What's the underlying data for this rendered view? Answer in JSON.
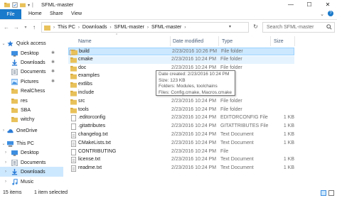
{
  "window": {
    "title": "SFML-master",
    "controls": {
      "minimize": "—",
      "maximize": "☐",
      "close": "✕"
    }
  },
  "ribbon": {
    "tabs": [
      "File",
      "Home",
      "Share",
      "View"
    ],
    "expand_caret": "⌄",
    "help": "?"
  },
  "address": {
    "segments": [
      "This PC",
      "Downloads",
      "SFML-master",
      "SFML-master"
    ],
    "separator": "›"
  },
  "search": {
    "placeholder": "Search SFML-master"
  },
  "nav": {
    "items": [
      {
        "label": "Quick access",
        "icon": "star-icon",
        "color": "#2a7bd6",
        "pinned": false,
        "level": 0,
        "expander": ""
      },
      {
        "label": "Desktop",
        "icon": "desktop-folder-icon",
        "color": "#3d8ee0",
        "pinned": true,
        "level": 1
      },
      {
        "label": "Downloads",
        "icon": "download-folder-icon",
        "color": "#2a7bd6",
        "pinned": true,
        "level": 1
      },
      {
        "label": "Documents",
        "icon": "documents-folder-icon",
        "color": "#6a7b8c",
        "pinned": true,
        "level": 1
      },
      {
        "label": "Pictures",
        "icon": "pictures-folder-icon",
        "color": "#3d8ee0",
        "pinned": true,
        "level": 1
      },
      {
        "label": "RealChess",
        "icon": "folder-icon",
        "color": "#e8c15a",
        "pinned": false,
        "level": 1
      },
      {
        "label": "res",
        "icon": "folder-icon",
        "color": "#e8c15a",
        "pinned": false,
        "level": 1
      },
      {
        "label": "SBA",
        "icon": "folder-icon",
        "color": "#e8c15a",
        "pinned": false,
        "level": 1
      },
      {
        "label": "witchy",
        "icon": "folder-icon",
        "color": "#e8c15a",
        "pinned": false,
        "level": 1
      },
      {
        "label": "OneDrive",
        "icon": "onedrive-icon",
        "color": "#2a7bd6",
        "pinned": false,
        "level": 0
      },
      {
        "label": "This PC",
        "icon": "this-pc-icon",
        "color": "#3d8ee0",
        "pinned": false,
        "level": 0
      },
      {
        "label": "Desktop",
        "icon": "desktop-folder-icon",
        "color": "#3d8ee0",
        "pinned": false,
        "level": 1
      },
      {
        "label": "Documents",
        "icon": "documents-folder-icon",
        "color": "#6a7b8c",
        "pinned": false,
        "level": 1
      },
      {
        "label": "Downloads",
        "icon": "download-folder-icon",
        "color": "#2a7bd6",
        "pinned": false,
        "level": 1,
        "selected": true
      },
      {
        "label": "Music",
        "icon": "music-folder-icon",
        "color": "#3d8ee0",
        "pinned": false,
        "level": 1
      }
    ]
  },
  "columns": {
    "name": "Name",
    "date": "Date modified",
    "type": "Type",
    "size": "Size"
  },
  "files": [
    {
      "name": "build",
      "date": "2/23/2016 10:26 PM",
      "type": "File folder",
      "size": "",
      "kind": "folder",
      "state": "selected"
    },
    {
      "name": "cmake",
      "date": "2/23/2016 10:24 PM",
      "type": "File folder",
      "size": "",
      "kind": "folder",
      "state": "hover"
    },
    {
      "name": "doc",
      "date": "2/23/2016 10:24 PM",
      "type": "File folder",
      "size": "",
      "kind": "folder"
    },
    {
      "name": "examples",
      "date": "",
      "type": "",
      "size": "",
      "kind": "folder"
    },
    {
      "name": "extlibs",
      "date": "",
      "type": "",
      "size": "",
      "kind": "folder"
    },
    {
      "name": "include",
      "date": "",
      "type": "",
      "size": "",
      "kind": "folder"
    },
    {
      "name": "src",
      "date": "2/23/2016 10:24 PM",
      "type": "File folder",
      "size": "",
      "kind": "folder"
    },
    {
      "name": "tools",
      "date": "2/23/2016 10:24 PM",
      "type": "File folder",
      "size": "",
      "kind": "folder"
    },
    {
      "name": ".editorconfig",
      "date": "2/23/2016 10:24 PM",
      "type": "EDITORCONFIG File",
      "size": "1 KB",
      "kind": "file"
    },
    {
      "name": ".gitattributes",
      "date": "2/23/2016 10:24 PM",
      "type": "GITATTRIBUTES File",
      "size": "1 KB",
      "kind": "file"
    },
    {
      "name": "changelog.txt",
      "date": "2/23/2016 10:24 PM",
      "type": "Text Document",
      "size": "1 KB",
      "kind": "text"
    },
    {
      "name": "CMakeLists.txt",
      "date": "2/23/2016 10:24 PM",
      "type": "Text Document",
      "size": "1 KB",
      "kind": "text"
    },
    {
      "name": "CONTRIBUTING",
      "date": "2/23/2016 10:24 PM",
      "type": "File",
      "size": "",
      "kind": "file"
    },
    {
      "name": "license.txt",
      "date": "2/23/2016 10:24 PM",
      "type": "Text Document",
      "size": "1 KB",
      "kind": "text"
    },
    {
      "name": "readme.txt",
      "date": "2/23/2016 10:24 PM",
      "type": "Text Document",
      "size": "1 KB",
      "kind": "text"
    }
  ],
  "tooltip": {
    "line1": "Date created: 2/23/2016 10:24 PM",
    "line2": "Size: 123 KB",
    "line3": "Folders: Modules, toolchains",
    "line4": "Files: Config.cmake, Macros.cmake"
  },
  "status": {
    "item_count": "15 items",
    "selected": "1 item selected"
  },
  "colors": {
    "accent": "#1979ca",
    "selection": "#cce8ff",
    "hover": "#e5f3ff",
    "folder": "#e8c15a"
  }
}
